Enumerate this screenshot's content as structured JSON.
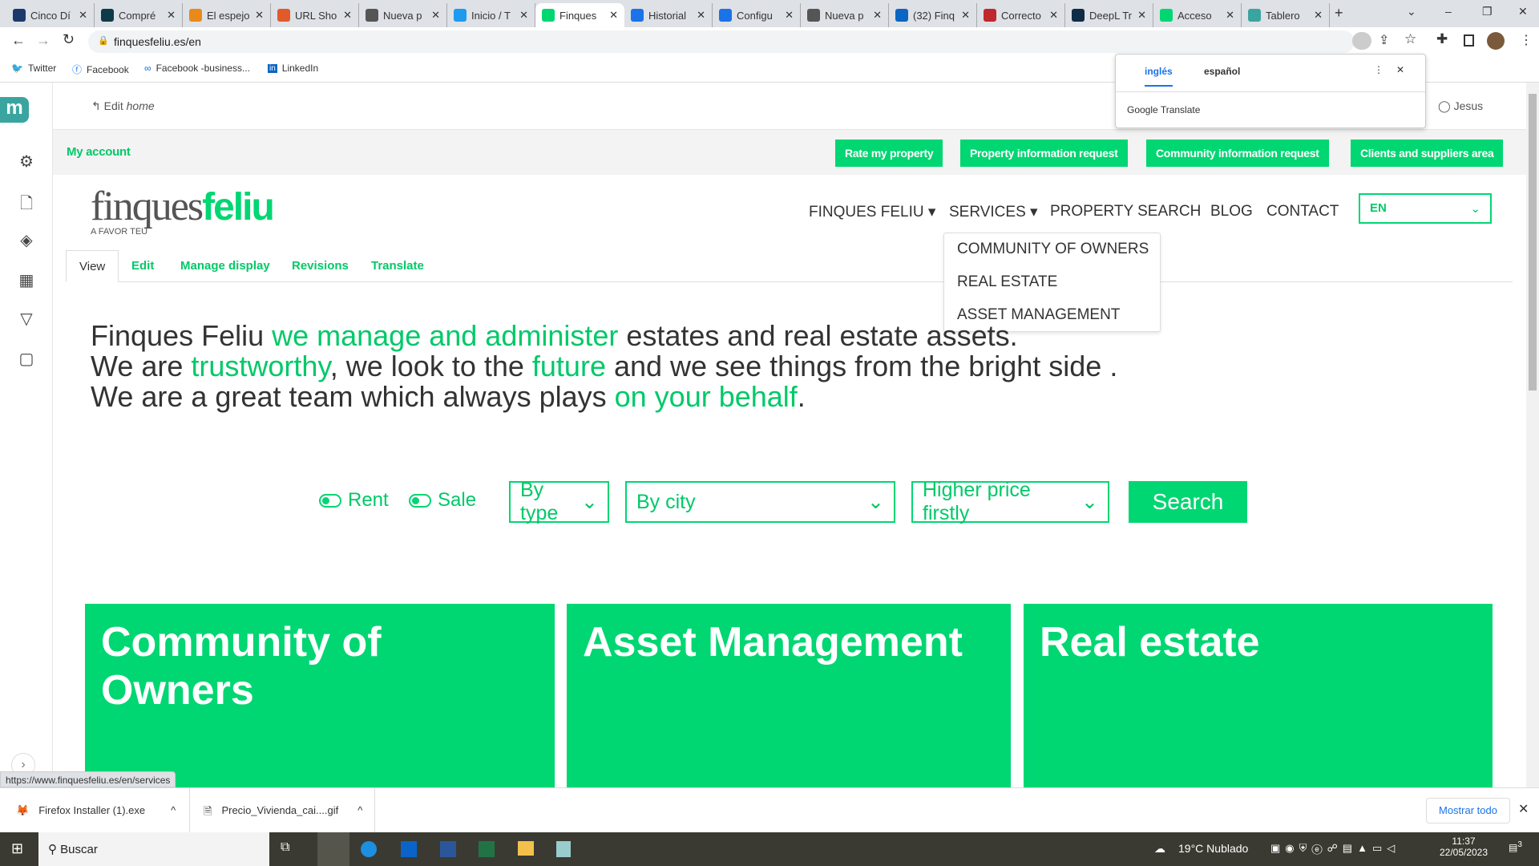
{
  "browser": {
    "tabs": [
      {
        "label": "Cinco Dí",
        "color": "#1b3a6b"
      },
      {
        "label": "Compré",
        "color": "#0e3b4a"
      },
      {
        "label": "El espejo",
        "color": "#e88a1a"
      },
      {
        "label": "URL Sho",
        "color": "#e05a2a"
      },
      {
        "label": "Nueva p",
        "color": "#555"
      },
      {
        "label": "Inicio / T",
        "color": "#1d9bf0"
      },
      {
        "label": "Finques",
        "color": "#00d672"
      },
      {
        "label": "Historial",
        "color": "#1a73e8"
      },
      {
        "label": "Configu",
        "color": "#1a73e8"
      },
      {
        "label": "Nueva p",
        "color": "#555"
      },
      {
        "label": "(32) Finq",
        "color": "#0a66c2"
      },
      {
        "label": "Correcto",
        "color": "#c0282d"
      },
      {
        "label": "DeepL Tr",
        "color": "#0f2b46"
      },
      {
        "label": "Acceso",
        "color": "#00d672"
      },
      {
        "label": "Tablero",
        "color": "#3aa5a0"
      }
    ],
    "active_tab": 6,
    "url": "finquesfeliu.es/en",
    "bookmarks": [
      "Twitter",
      "Facebook",
      "Facebook -business...",
      "LinkedIn"
    ],
    "status_url": "https://www.finquesfeliu.es/en/services"
  },
  "translate": {
    "lang1": "inglés",
    "lang2": "español",
    "brand": "Google Translate"
  },
  "admin": {
    "edit_label": "Edit",
    "edit_target": "home",
    "user": "Jesus"
  },
  "topbar": {
    "my_account": "My account",
    "buttons": [
      "Rate my property",
      "Property information request",
      "Community information request",
      "Clients and suppliers area"
    ]
  },
  "logo": {
    "part1": "finques",
    "part2": "feliu",
    "tagline": "A FAVOR TEU"
  },
  "nav": {
    "items": [
      "FINQUES FELIU",
      "SERVICES",
      "PROPERTY SEARCH",
      "BLOG",
      "CONTACT"
    ],
    "lang": "EN",
    "services_menu": [
      "COMMUNITY OF OWNERS",
      "REAL ESTATE",
      "ASSET MANAGEMENT"
    ]
  },
  "edit_tabs": [
    "View",
    "Edit",
    "Manage display",
    "Revisions",
    "Translate"
  ],
  "hero": {
    "l1a": "Finques Feliu ",
    "l1b": "we manage and administer",
    "l1c": " estates and real estate assets.",
    "l2a": "We are ",
    "l2b": "trustworthy",
    "l2c": ", we look to the ",
    "l2d": "future",
    "l2e": " and we see things from the bright side .",
    "l3a": "We are a great team which always plays ",
    "l3b": "on your behalf",
    "l3c": "."
  },
  "search": {
    "rent": "Rent",
    "sale": "Sale",
    "type": "By type",
    "city": "By city",
    "order": "Higher price firstly",
    "button": "Search"
  },
  "cards": [
    "Community of Owners",
    "Asset Management",
    "Real estate"
  ],
  "downloads": {
    "items": [
      "Firefox Installer (1).exe",
      "Precio_Vivienda_cai....gif"
    ],
    "show_all": "Mostrar todo"
  },
  "taskbar": {
    "search": "Buscar",
    "weather": "19°C  Nublado",
    "time": "11:37",
    "date": "22/05/2023",
    "notifications": "3"
  },
  "colors": {
    "brand_green": "#00d672"
  }
}
